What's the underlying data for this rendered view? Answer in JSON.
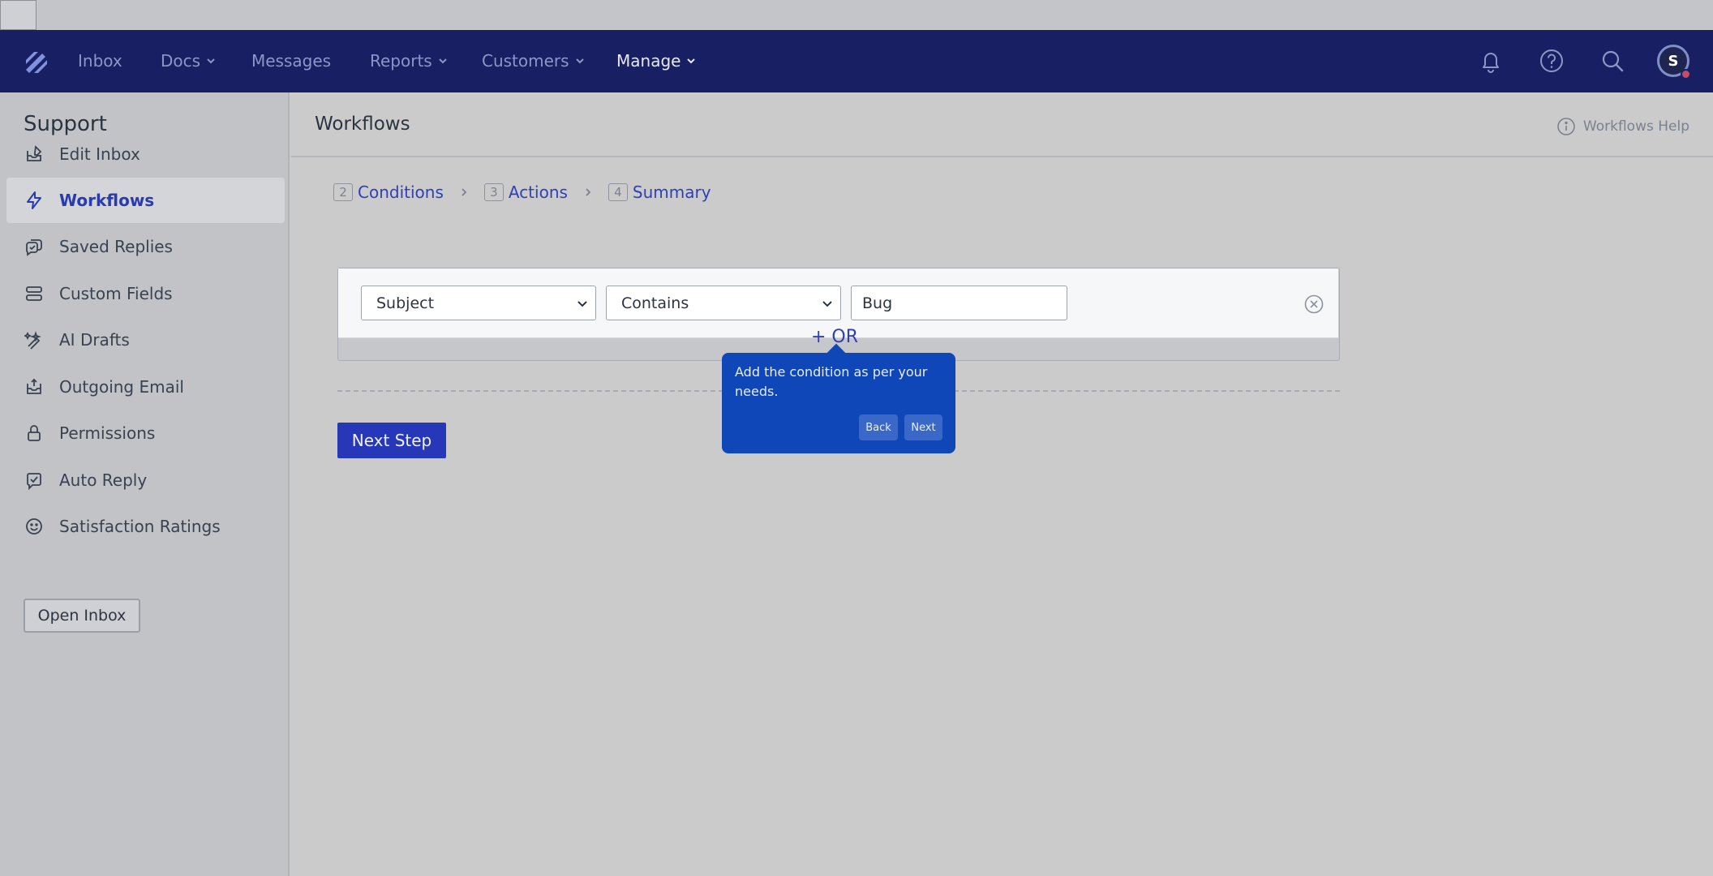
{
  "nav": {
    "items": [
      {
        "label": "Inbox",
        "has_menu": false
      },
      {
        "label": "Docs",
        "has_menu": true
      },
      {
        "label": "Messages",
        "has_menu": false
      },
      {
        "label": "Reports",
        "has_menu": true
      },
      {
        "label": "Customers",
        "has_menu": true
      },
      {
        "label": "Manage",
        "has_menu": true,
        "active": true
      }
    ],
    "icons": [
      "bell-icon",
      "help-circle-icon",
      "search-icon"
    ],
    "avatar_initial": "S"
  },
  "sidebar": {
    "title": "Support",
    "items": [
      {
        "label": "Edit Inbox",
        "icon": "edit-inbox-icon"
      },
      {
        "label": "Workflows",
        "icon": "lightning-icon",
        "active": true
      },
      {
        "label": "Saved Replies",
        "icon": "saved-replies-icon"
      },
      {
        "label": "Custom Fields",
        "icon": "custom-fields-icon"
      },
      {
        "label": "AI Drafts",
        "icon": "ai-drafts-icon"
      },
      {
        "label": "Outgoing Email",
        "icon": "outgoing-email-icon"
      },
      {
        "label": "Permissions",
        "icon": "lock-icon"
      },
      {
        "label": "Auto Reply",
        "icon": "auto-reply-icon"
      },
      {
        "label": "Satisfaction Ratings",
        "icon": "smiley-icon"
      }
    ],
    "open_inbox_label": "Open Inbox"
  },
  "page": {
    "title": "Workflows",
    "help_label": "Workflows Help"
  },
  "steps": [
    {
      "num": "2",
      "label": "Conditions"
    },
    {
      "num": "3",
      "label": "Actions"
    },
    {
      "num": "4",
      "label": "Summary"
    }
  ],
  "condition": {
    "field_value": "Subject",
    "operator_value": "Contains",
    "text_value": "Bug",
    "or_label": "+ OR"
  },
  "next_step_label": "Next Step",
  "tour": {
    "text": "Add the condition as per your needs.",
    "back_label": "Back",
    "next_label": "Next"
  },
  "colors": {
    "navbar": "#182063",
    "accent": "#2638b8",
    "tour": "#0f47b8"
  }
}
